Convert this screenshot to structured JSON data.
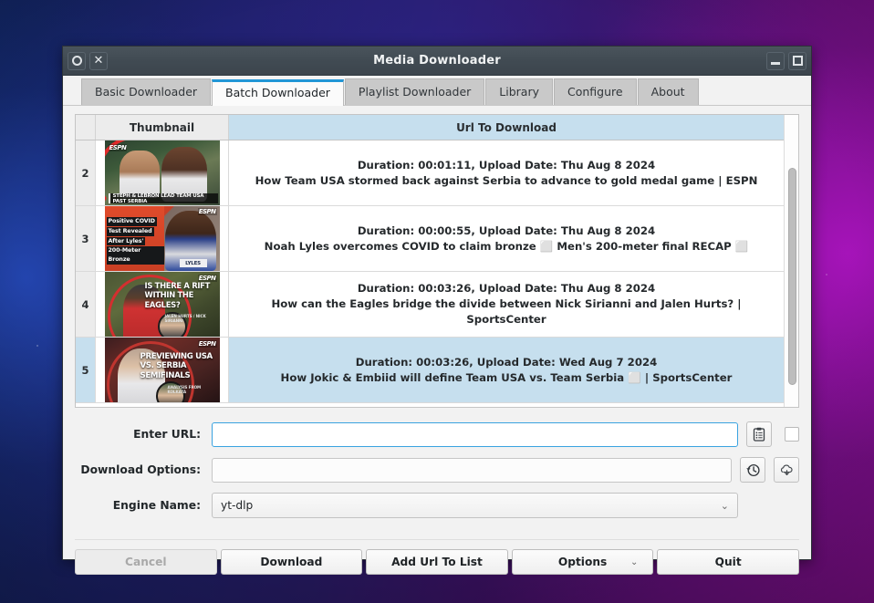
{
  "window": {
    "title": "Media Downloader",
    "controls": {
      "shade": "shade-icon",
      "close": "close-icon",
      "minimize": "minimize-icon",
      "maximize": "maximize-icon"
    }
  },
  "tabs": [
    {
      "label": "Basic Downloader",
      "active": false
    },
    {
      "label": "Batch Downloader",
      "active": true
    },
    {
      "label": "Playlist Downloader",
      "active": false
    },
    {
      "label": "Library",
      "active": false
    },
    {
      "label": "Configure",
      "active": false
    },
    {
      "label": "About",
      "active": false
    }
  ],
  "table": {
    "headers": {
      "thumbnail": "Thumbnail",
      "url": "Url To Download"
    },
    "rows": [
      {
        "num": "2",
        "meta": "Duration: 00:01:11, Upload Date: Thu Aug 8 2024",
        "title": "How Team USA stormed back against Serbia to advance to gold medal game | ESPN",
        "selected": false,
        "thumb": {
          "style": "A",
          "logo": "ESPN",
          "caption": "STEPH & LEBRON LEAD TEAM USA PAST SERBIA"
        }
      },
      {
        "num": "3",
        "meta": "Duration: 00:00:55, Upload Date: Thu Aug 8 2024",
        "title": "Noah Lyles overcomes COVID to claim bronze ⬜ Men's 200-meter final RECAP ⬜",
        "selected": false,
        "thumb": {
          "style": "B",
          "logo": "ESPN",
          "lines": [
            "Positive COVID",
            "Test Revealed",
            "After Lyles'",
            "200-Meter Bronze"
          ],
          "bib": "LYLES"
        }
      },
      {
        "num": "4",
        "meta": "Duration: 00:03:26, Upload Date: Thu Aug 8 2024",
        "title": "How can the Eagles bridge the divide between Nick Sirianni and Jalen Hurts? | SportsCenter",
        "selected": false,
        "thumb": {
          "style": "C",
          "logo": "ESPN",
          "headline": "IS THERE A RIFT WITHIN THE EAGLES?",
          "sub": "JALEN HURTS / NICK SIRIANNI"
        }
      },
      {
        "num": "5",
        "meta": "Duration: 00:03:26, Upload Date: Wed Aug 7 2024",
        "title": "How Jokic & Embiid will define Team USA vs. Team Serbia ⬜ | SportsCenter",
        "selected": true,
        "thumb": {
          "style": "D",
          "logo": "ESPN",
          "headline": "PREVIEWING USA VS. SERBIA SEMIFINALS",
          "sub": "ANALYSIS FROM KOLKATA"
        }
      }
    ]
  },
  "form": {
    "url": {
      "label": "Enter URL:",
      "value": "",
      "placeholder": "",
      "paste_icon": "clipboard-paste-icon",
      "checkbox_checked": false
    },
    "options": {
      "label": "Download Options:",
      "value": "",
      "placeholder": "",
      "history_icon": "clock-history-icon",
      "download_icon": "cloud-download-icon"
    },
    "engine": {
      "label": "Engine Name:",
      "value": "yt-dlp",
      "chevron": "⌄"
    }
  },
  "buttons": {
    "cancel": "Cancel",
    "download": "Download",
    "add_url": "Add Url To List",
    "options": "Options",
    "options_chevron": "⌄",
    "quit": "Quit"
  },
  "colors": {
    "accent": "#2196d6",
    "selection": "#c6dfee",
    "titlebar": "#414b53"
  }
}
